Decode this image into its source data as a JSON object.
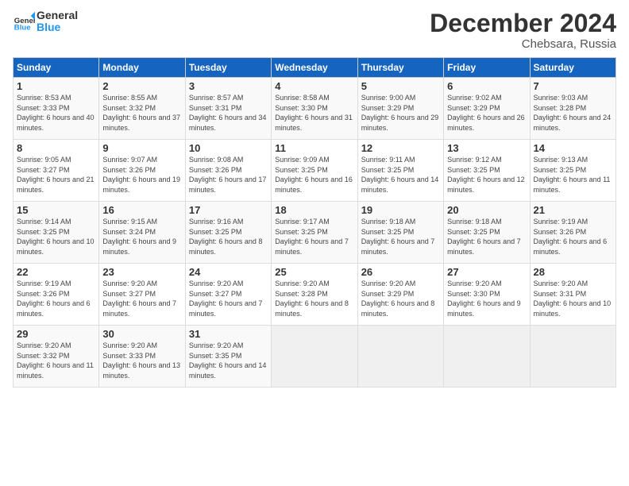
{
  "logo": {
    "text_general": "General",
    "text_blue": "Blue"
  },
  "header": {
    "month": "December 2024",
    "location": "Chebsara, Russia"
  },
  "days_of_week": [
    "Sunday",
    "Monday",
    "Tuesday",
    "Wednesday",
    "Thursday",
    "Friday",
    "Saturday"
  ],
  "weeks": [
    [
      {
        "day": "1",
        "sunrise": "Sunrise: 8:53 AM",
        "sunset": "Sunset: 3:33 PM",
        "daylight": "Daylight: 6 hours and 40 minutes."
      },
      {
        "day": "2",
        "sunrise": "Sunrise: 8:55 AM",
        "sunset": "Sunset: 3:32 PM",
        "daylight": "Daylight: 6 hours and 37 minutes."
      },
      {
        "day": "3",
        "sunrise": "Sunrise: 8:57 AM",
        "sunset": "Sunset: 3:31 PM",
        "daylight": "Daylight: 6 hours and 34 minutes."
      },
      {
        "day": "4",
        "sunrise": "Sunrise: 8:58 AM",
        "sunset": "Sunset: 3:30 PM",
        "daylight": "Daylight: 6 hours and 31 minutes."
      },
      {
        "day": "5",
        "sunrise": "Sunrise: 9:00 AM",
        "sunset": "Sunset: 3:29 PM",
        "daylight": "Daylight: 6 hours and 29 minutes."
      },
      {
        "day": "6",
        "sunrise": "Sunrise: 9:02 AM",
        "sunset": "Sunset: 3:29 PM",
        "daylight": "Daylight: 6 hours and 26 minutes."
      },
      {
        "day": "7",
        "sunrise": "Sunrise: 9:03 AM",
        "sunset": "Sunset: 3:28 PM",
        "daylight": "Daylight: 6 hours and 24 minutes."
      }
    ],
    [
      {
        "day": "8",
        "sunrise": "Sunrise: 9:05 AM",
        "sunset": "Sunset: 3:27 PM",
        "daylight": "Daylight: 6 hours and 21 minutes."
      },
      {
        "day": "9",
        "sunrise": "Sunrise: 9:07 AM",
        "sunset": "Sunset: 3:26 PM",
        "daylight": "Daylight: 6 hours and 19 minutes."
      },
      {
        "day": "10",
        "sunrise": "Sunrise: 9:08 AM",
        "sunset": "Sunset: 3:26 PM",
        "daylight": "Daylight: 6 hours and 17 minutes."
      },
      {
        "day": "11",
        "sunrise": "Sunrise: 9:09 AM",
        "sunset": "Sunset: 3:25 PM",
        "daylight": "Daylight: 6 hours and 16 minutes."
      },
      {
        "day": "12",
        "sunrise": "Sunrise: 9:11 AM",
        "sunset": "Sunset: 3:25 PM",
        "daylight": "Daylight: 6 hours and 14 minutes."
      },
      {
        "day": "13",
        "sunrise": "Sunrise: 9:12 AM",
        "sunset": "Sunset: 3:25 PM",
        "daylight": "Daylight: 6 hours and 12 minutes."
      },
      {
        "day": "14",
        "sunrise": "Sunrise: 9:13 AM",
        "sunset": "Sunset: 3:25 PM",
        "daylight": "Daylight: 6 hours and 11 minutes."
      }
    ],
    [
      {
        "day": "15",
        "sunrise": "Sunrise: 9:14 AM",
        "sunset": "Sunset: 3:25 PM",
        "daylight": "Daylight: 6 hours and 10 minutes."
      },
      {
        "day": "16",
        "sunrise": "Sunrise: 9:15 AM",
        "sunset": "Sunset: 3:24 PM",
        "daylight": "Daylight: 6 hours and 9 minutes."
      },
      {
        "day": "17",
        "sunrise": "Sunrise: 9:16 AM",
        "sunset": "Sunset: 3:25 PM",
        "daylight": "Daylight: 6 hours and 8 minutes."
      },
      {
        "day": "18",
        "sunrise": "Sunrise: 9:17 AM",
        "sunset": "Sunset: 3:25 PM",
        "daylight": "Daylight: 6 hours and 7 minutes."
      },
      {
        "day": "19",
        "sunrise": "Sunrise: 9:18 AM",
        "sunset": "Sunset: 3:25 PM",
        "daylight": "Daylight: 6 hours and 7 minutes."
      },
      {
        "day": "20",
        "sunrise": "Sunrise: 9:18 AM",
        "sunset": "Sunset: 3:25 PM",
        "daylight": "Daylight: 6 hours and 7 minutes."
      },
      {
        "day": "21",
        "sunrise": "Sunrise: 9:19 AM",
        "sunset": "Sunset: 3:26 PM",
        "daylight": "Daylight: 6 hours and 6 minutes."
      }
    ],
    [
      {
        "day": "22",
        "sunrise": "Sunrise: 9:19 AM",
        "sunset": "Sunset: 3:26 PM",
        "daylight": "Daylight: 6 hours and 6 minutes."
      },
      {
        "day": "23",
        "sunrise": "Sunrise: 9:20 AM",
        "sunset": "Sunset: 3:27 PM",
        "daylight": "Daylight: 6 hours and 7 minutes."
      },
      {
        "day": "24",
        "sunrise": "Sunrise: 9:20 AM",
        "sunset": "Sunset: 3:27 PM",
        "daylight": "Daylight: 6 hours and 7 minutes."
      },
      {
        "day": "25",
        "sunrise": "Sunrise: 9:20 AM",
        "sunset": "Sunset: 3:28 PM",
        "daylight": "Daylight: 6 hours and 8 minutes."
      },
      {
        "day": "26",
        "sunrise": "Sunrise: 9:20 AM",
        "sunset": "Sunset: 3:29 PM",
        "daylight": "Daylight: 6 hours and 8 minutes."
      },
      {
        "day": "27",
        "sunrise": "Sunrise: 9:20 AM",
        "sunset": "Sunset: 3:30 PM",
        "daylight": "Daylight: 6 hours and 9 minutes."
      },
      {
        "day": "28",
        "sunrise": "Sunrise: 9:20 AM",
        "sunset": "Sunset: 3:31 PM",
        "daylight": "Daylight: 6 hours and 10 minutes."
      }
    ],
    [
      {
        "day": "29",
        "sunrise": "Sunrise: 9:20 AM",
        "sunset": "Sunset: 3:32 PM",
        "daylight": "Daylight: 6 hours and 11 minutes."
      },
      {
        "day": "30",
        "sunrise": "Sunrise: 9:20 AM",
        "sunset": "Sunset: 3:33 PM",
        "daylight": "Daylight: 6 hours and 13 minutes."
      },
      {
        "day": "31",
        "sunrise": "Sunrise: 9:20 AM",
        "sunset": "Sunset: 3:35 PM",
        "daylight": "Daylight: 6 hours and 14 minutes."
      },
      null,
      null,
      null,
      null
    ]
  ]
}
